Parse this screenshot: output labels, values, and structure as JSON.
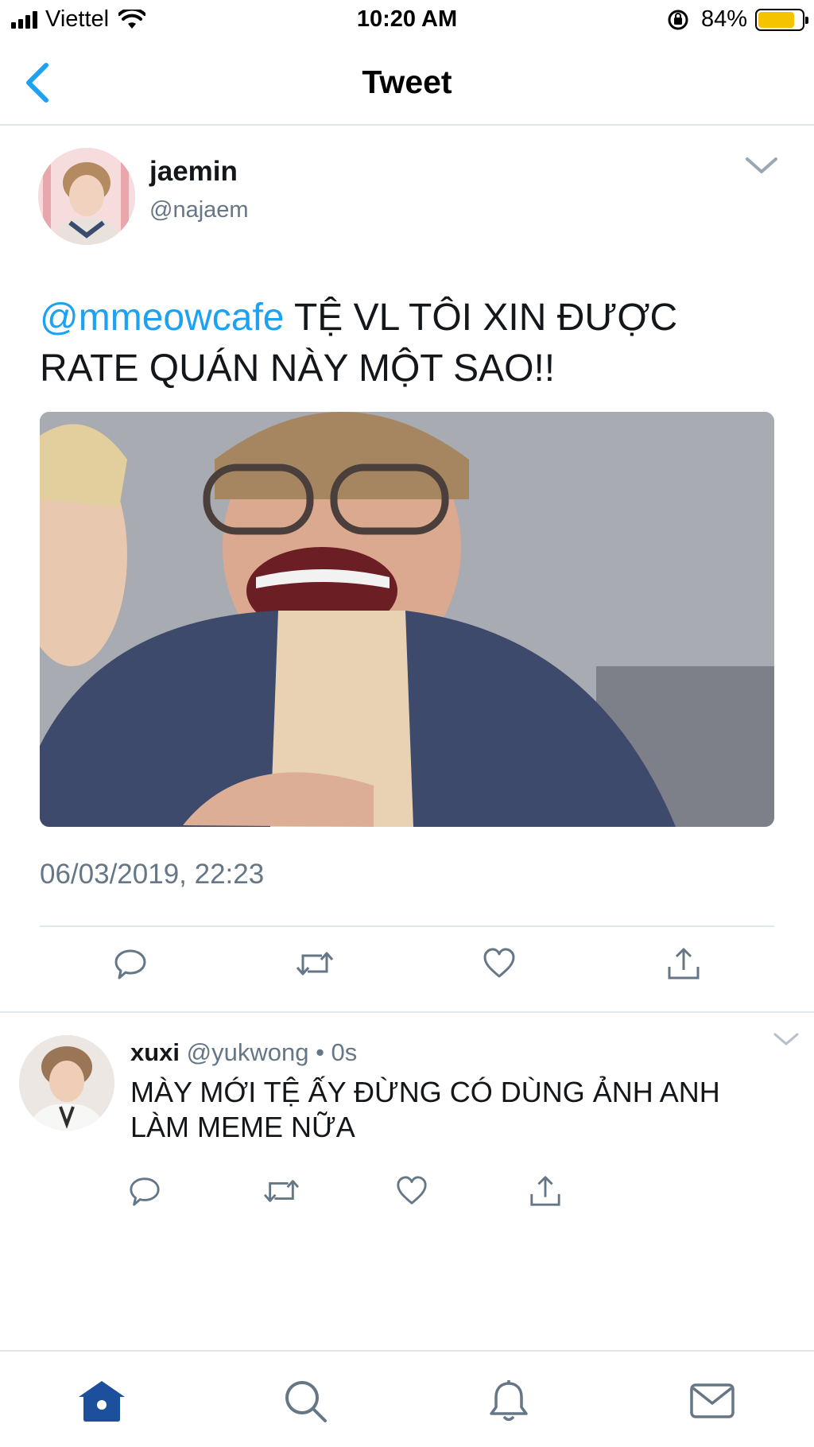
{
  "status_bar": {
    "carrier": "Viettel",
    "time": "10:20 AM",
    "battery_percent": "84%",
    "battery_level": 0.84,
    "battery_color": "#f5c400"
  },
  "nav": {
    "title": "Tweet",
    "back_icon": "chevron-left-icon",
    "accent_color": "#1da1f2"
  },
  "tweet": {
    "author_name": "jaemin",
    "author_handle": "@najaem",
    "mention": "@mmeowcafe",
    "text": " TỆ VL TÔI XIN ĐƯỢC RATE QUÁN NÀY MỘT SAO!!",
    "timestamp": "06/03/2019, 22:23",
    "actions": [
      "reply-icon",
      "retweet-icon",
      "like-icon",
      "share-icon"
    ]
  },
  "reply": {
    "author_name": "xuxi",
    "meta": " @yukwong • 0s",
    "text": "MÀY MỚI TỆ ẤY ĐỪNG CÓ DÙNG ẢNH ANH LÀM MEME NỮA",
    "actions": [
      "reply-icon",
      "retweet-icon",
      "like-icon",
      "share-icon"
    ]
  },
  "tab_bar": {
    "tabs": [
      "home-icon",
      "search-icon",
      "notifications-icon",
      "messages-icon"
    ],
    "active_tab": "home-icon",
    "active_color": "#1c4f9c"
  }
}
